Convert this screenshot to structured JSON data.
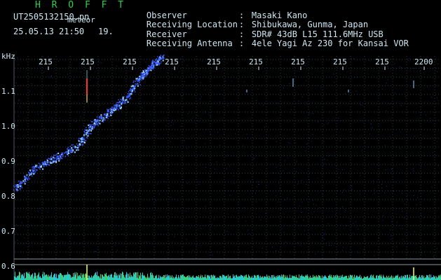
{
  "header": {
    "brand": "H R O F F T",
    "filename": "UT2505132150.pn",
    "filename_suffix": "meteor",
    "datetime": "25.05.13 21:50",
    "datetime_extra": "19.",
    "info_rows": [
      {
        "key": "Observer",
        "sep": ":",
        "value": "Masaki Kano"
      },
      {
        "key": "Receiving Location",
        "sep": ":",
        "value": "Shibukawa, Gunma, Japan"
      },
      {
        "key": "Receiver",
        "sep": ":",
        "value": "SDR# 43dB L15 111.6MHz USB"
      },
      {
        "key": "Receiving Antenna",
        "sep": ":",
        "value": "4ele Yagi Az 230 for Kansai VOR"
      }
    ]
  },
  "chart_data": {
    "type": "heatmap",
    "y_unit_label": "kHz",
    "x_tick_labels": [
      "215",
      "215",
      "215",
      "215",
      "215",
      "215",
      "215",
      "215",
      "215",
      "2200"
    ],
    "y_tick_labels": [
      "1.1",
      "1.0",
      "0.9",
      "0.8",
      "0.7",
      "0.6"
    ],
    "y_ticks": [
      1.1,
      1.0,
      0.9,
      0.8,
      0.7,
      0.6
    ],
    "ylim": [
      0.595,
      1.2
    ],
    "grid": true,
    "colors": {
      "background": "#000000",
      "grid": "#2a3f45",
      "signal": "#3a5cff",
      "signal_bright": "#9ad8ff",
      "echo_red": "#ff3030",
      "spectrum": "#28c8d8",
      "spectrum_peak": "#ffff40",
      "axis_text": "#cfe7f2"
    }
  }
}
